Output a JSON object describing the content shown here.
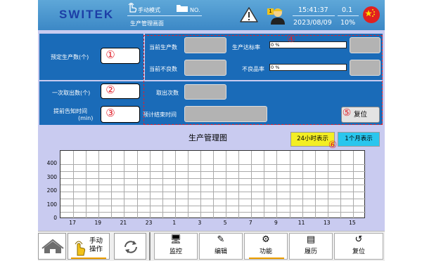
{
  "header": {
    "logo": "SWITEK",
    "mode": "手动模式",
    "no_label": "NO.",
    "screen": "生产管理画面",
    "time": "15:41:37",
    "date": "2023/08/09",
    "value1": "0.1",
    "value2": "10%",
    "badge": "1"
  },
  "form": {
    "preset_label": "预定生产数(个)",
    "current_prod_label": "当前生产数",
    "current_bad_label": "当前不良数",
    "rate_label": "生产达标率",
    "rate_value": "0 %",
    "bad_rate_label": "不良品率",
    "bad_rate_value": "0 %",
    "once_label": "一次取出数(个)",
    "takeout_label": "取出次数",
    "notify_label1": "提前告知时间",
    "notify_label2": "(min)",
    "end_time_label": "预计结束时间",
    "reset_label": "复位"
  },
  "markers": [
    "①",
    "②",
    "③",
    "④",
    "⑤",
    "⑥"
  ],
  "chart_title": "生产管理图",
  "btn_24h": "24小时表示",
  "btn_month": "1个月表示",
  "chart_data": {
    "type": "line",
    "title": "生产管理图",
    "x_ticks": [
      "17",
      "19",
      "21",
      "23",
      "1",
      "3",
      "5",
      "7",
      "9",
      "11",
      "13",
      "15"
    ],
    "y_ticks": [
      "400",
      "300",
      "200",
      "100",
      "0"
    ],
    "ylim": [
      0,
      400
    ],
    "grid": true,
    "series": []
  },
  "nav": {
    "manual": "手动\n操作",
    "monitor": "监控",
    "edit": "编辑",
    "function": "功能",
    "history": "履历",
    "reset": "复位"
  },
  "colors": {
    "header": "#3c88c6",
    "panel": "#1a6bb8",
    "frame": "#c9cbf0",
    "marker": "#e0202a",
    "active": "#f0a000"
  }
}
